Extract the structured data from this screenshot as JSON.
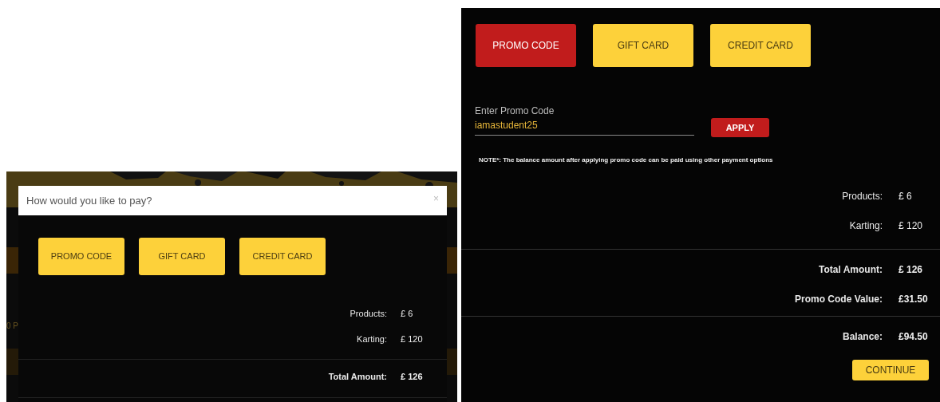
{
  "left_screen": {
    "background_text": "0 P",
    "dialog": {
      "title": "How would you like to pay?",
      "close": "×",
      "payment_options": [
        {
          "label": "PROMO CODE",
          "selected": false
        },
        {
          "label": "GIFT CARD",
          "selected": false
        },
        {
          "label": "CREDIT CARD",
          "selected": false
        }
      ],
      "summary_sections": [
        [
          {
            "label": "Products:",
            "value": "£ 6",
            "kind": "item"
          },
          {
            "label": "Karting:",
            "value": "£ 120",
            "kind": "item"
          }
        ],
        [
          {
            "label": "Total Amount:",
            "value": "£ 126",
            "kind": "total"
          }
        ]
      ]
    }
  },
  "right_screen": {
    "payment_options": [
      {
        "label": "PROMO CODE",
        "selected": true
      },
      {
        "label": "GIFT CARD",
        "selected": false
      },
      {
        "label": "CREDIT CARD",
        "selected": false
      }
    ],
    "promo_field": {
      "label": "Enter Promo Code",
      "value": "iamastudent25"
    },
    "apply_button": "APPLY",
    "note": "NOTE*: The balance amount after applying promo code can be paid using other payment options",
    "summary_sections": [
      [
        {
          "label": "Products:",
          "value": "£ 6",
          "kind": "item"
        },
        {
          "label": "Karting:",
          "value": "£ 120",
          "kind": "item"
        }
      ],
      [
        {
          "label": "Total Amount:",
          "value": "£ 126",
          "kind": "total"
        },
        {
          "label": "Promo Code Value:",
          "value": "£31.50",
          "kind": "total"
        }
      ],
      [
        {
          "label": "Balance:",
          "value": "£94.50",
          "kind": "total"
        }
      ]
    ],
    "continue_button": "CONTINUE"
  }
}
